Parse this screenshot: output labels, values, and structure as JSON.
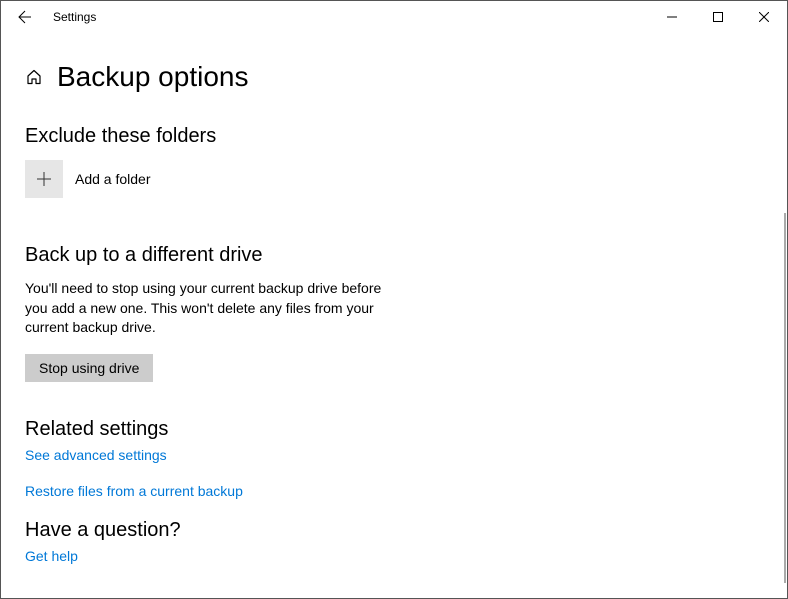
{
  "window": {
    "title": "Settings"
  },
  "header": {
    "title": "Backup options"
  },
  "sections": {
    "exclude": {
      "heading": "Exclude these folders",
      "add_label": "Add a folder"
    },
    "drive": {
      "heading": "Back up to a different drive",
      "description": "You'll need to stop using your current backup drive before you add a new one. This won't delete any files from your current backup drive.",
      "button_label": "Stop using drive"
    },
    "related": {
      "heading": "Related settings",
      "link1": "See advanced settings",
      "link2": "Restore files from a current backup"
    },
    "question": {
      "heading": "Have a question?",
      "link": "Get help"
    }
  }
}
